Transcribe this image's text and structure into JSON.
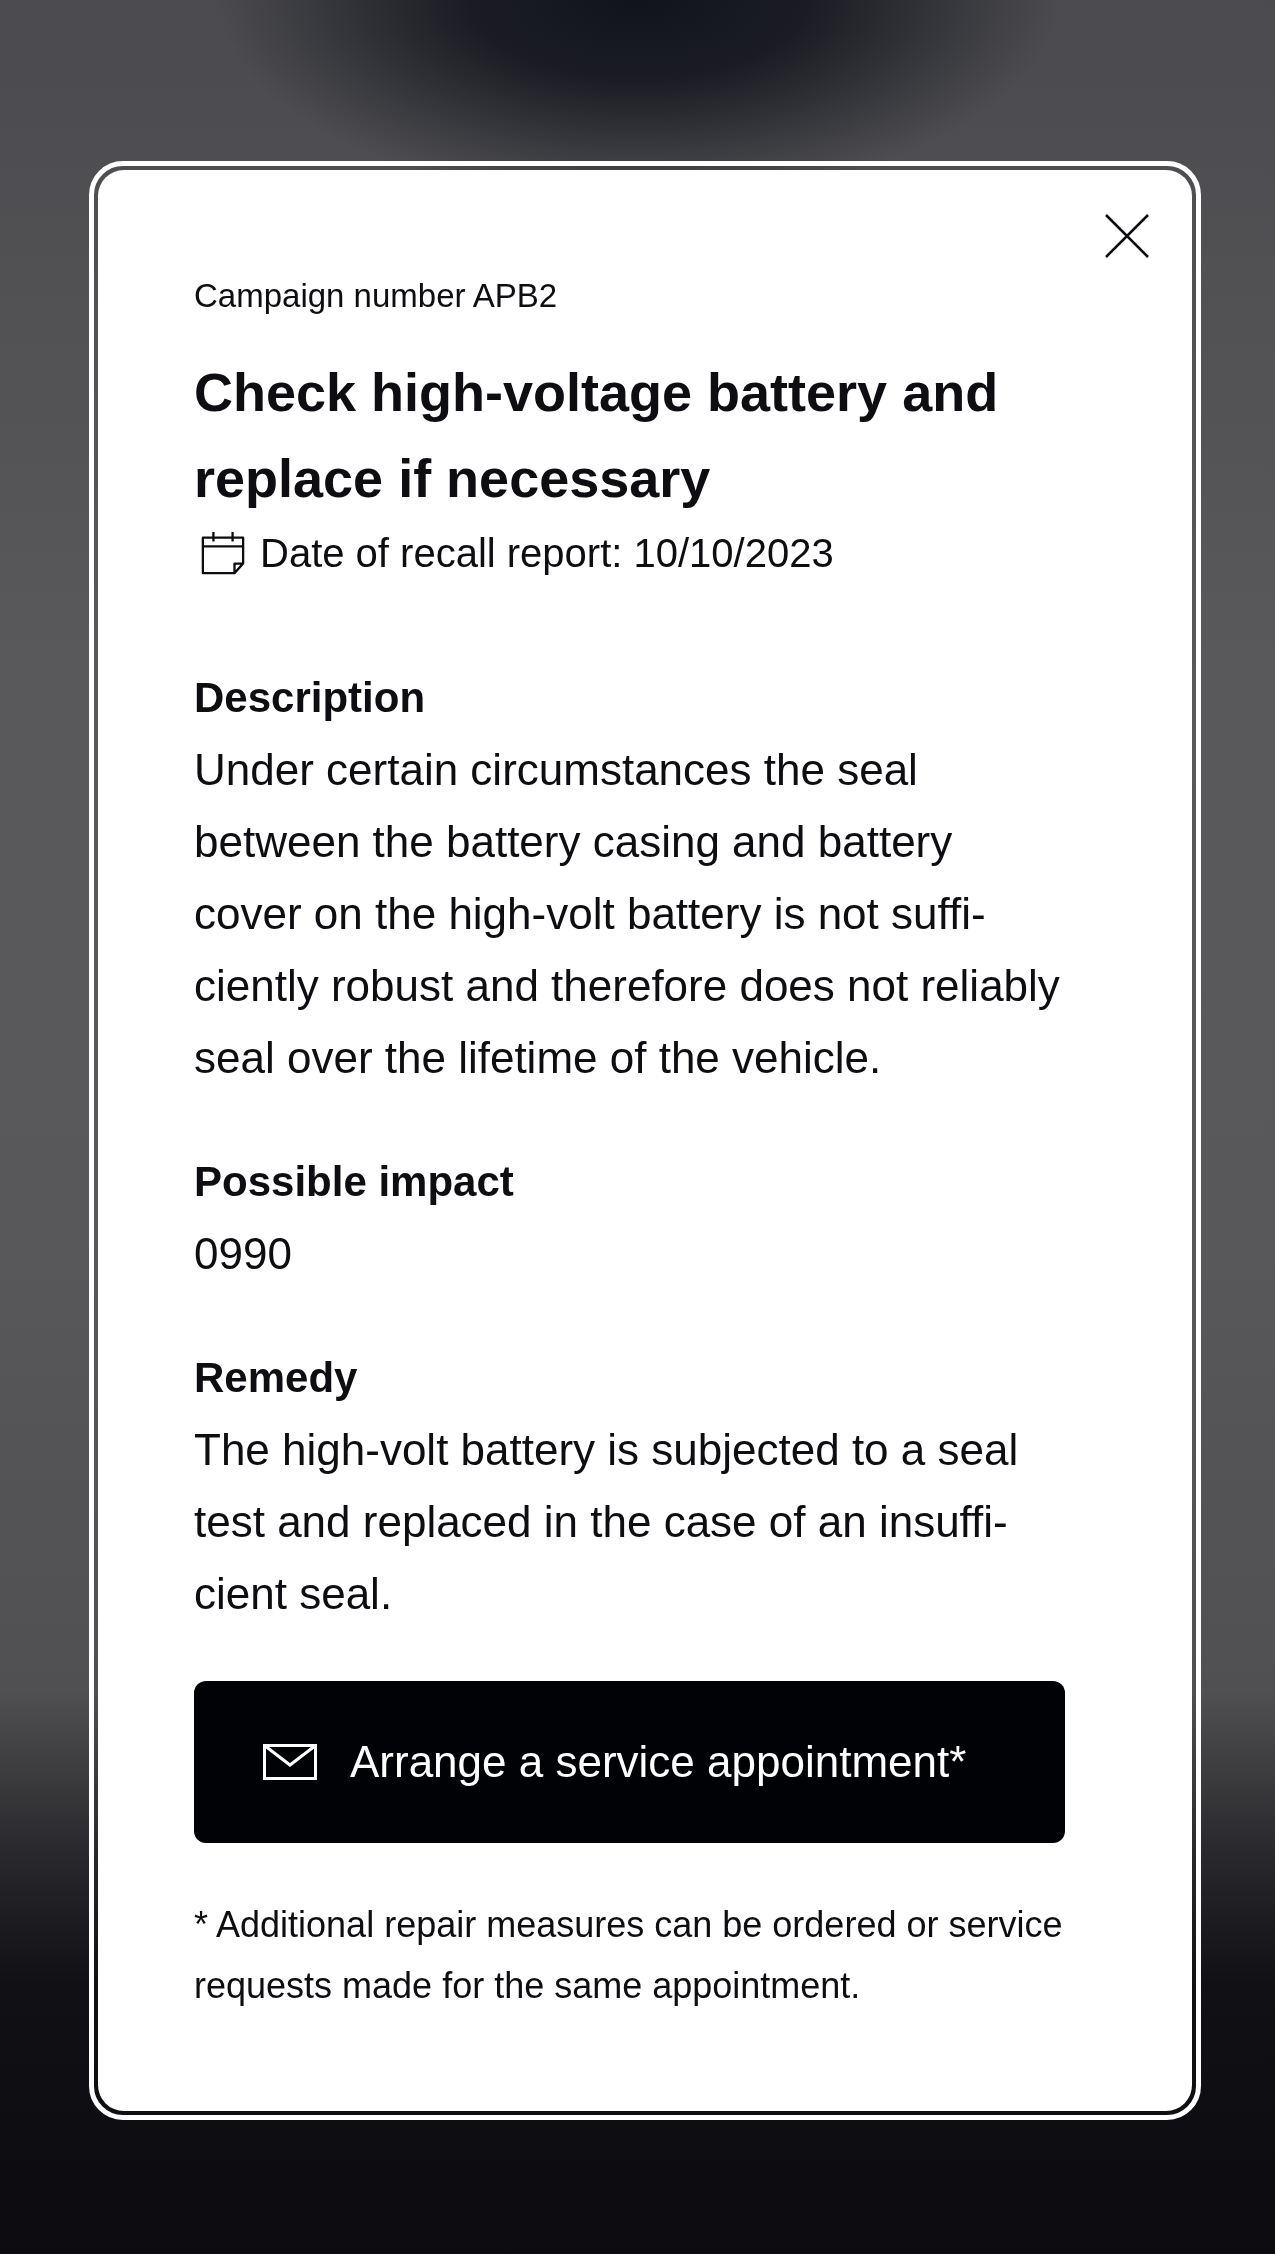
{
  "dialog": {
    "campaign_number": "Campaign number APB2",
    "title": "Check high-voltage battery and replace if necessary",
    "recall_date": "Date of recall report: 10/10/2023",
    "sections": [
      {
        "heading": "Description",
        "lines": [
          "Under certain circumstances the seal",
          "between the battery casing and battery",
          "cover on the high-volt battery is not suffi-",
          "ciently robust and therefore does not reliably",
          "seal over the lifetime of the vehicle."
        ]
      },
      {
        "heading": "Possible impact",
        "lines": [
          "0990"
        ]
      },
      {
        "heading": "Remedy",
        "lines": [
          "The high-volt battery is subjected to a seal",
          "test and replaced in the case of an insuffi-",
          "cient seal."
        ]
      }
    ],
    "button": {
      "label": "Arrange a service appointment*"
    },
    "footnote": "* Additional repair measures can be ordered or service requests made for the same appointment."
  }
}
